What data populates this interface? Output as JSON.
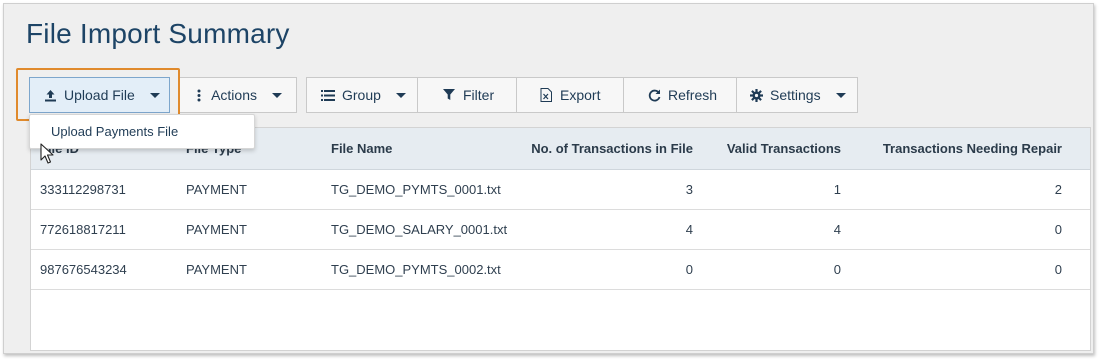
{
  "page": {
    "title": "File Import Summary"
  },
  "toolbar": {
    "upload_label": "Upload File",
    "actions_label": "Actions",
    "group_label": "Group",
    "filter_label": "Filter",
    "export_label": "Export",
    "refresh_label": "Refresh",
    "settings_label": "Settings"
  },
  "upload_menu": {
    "items": [
      "Upload Payments File"
    ]
  },
  "table": {
    "columns": [
      "File ID",
      "File Type",
      "File Name",
      "No. of Transactions in File",
      "Valid Transactions",
      "Transactions Needing Repair"
    ],
    "rows": [
      [
        "333112298731",
        "PAYMENT",
        "TG_DEMO_PYMTS_0001.txt",
        "3",
        "1",
        "2"
      ],
      [
        "772618817211",
        "PAYMENT",
        "TG_DEMO_SALARY_0001.txt",
        "4",
        "4",
        "0"
      ],
      [
        "987676543234",
        "PAYMENT",
        "TG_DEMO_PYMTS_0002.txt",
        "0",
        "0",
        "0"
      ]
    ]
  },
  "colors": {
    "accent_highlight": "#e08a2c",
    "title": "#1d4466",
    "header_bg": "#e6ecf1"
  }
}
